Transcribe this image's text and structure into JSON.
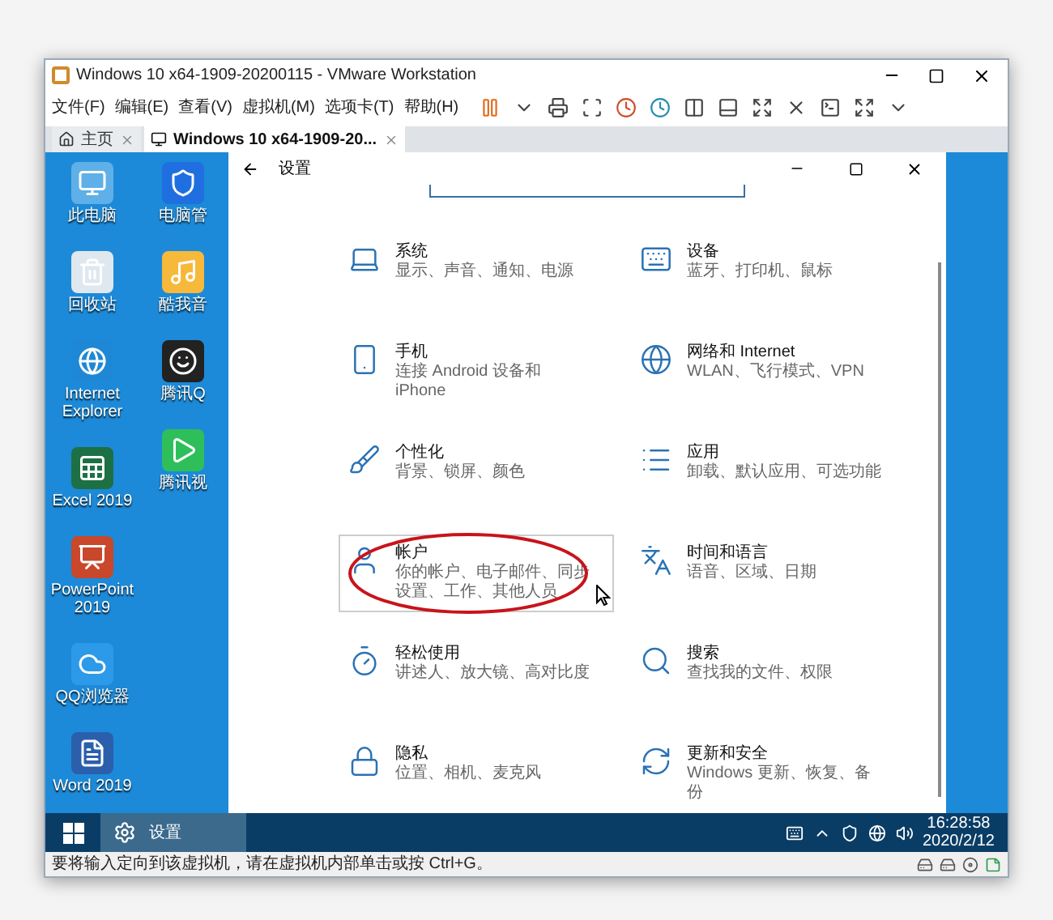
{
  "window": {
    "title": "Windows 10 x64-1909-20200115 - VMware Workstation"
  },
  "menu": [
    "文件(F)",
    "编辑(E)",
    "查看(V)",
    "虚拟机(M)",
    "选项卡(T)",
    "帮助(H)"
  ],
  "tabs": [
    {
      "label": "主页",
      "selected": false
    },
    {
      "label": "Windows 10 x64-1909-20...",
      "selected": true
    }
  ],
  "desktop_icons": [
    {
      "label": "此电脑",
      "kind": "pc"
    },
    {
      "label": "回收站",
      "kind": "bin"
    },
    {
      "label": "Internet Explorer",
      "kind": "ie"
    },
    {
      "label": "Excel 2019",
      "kind": "excel"
    },
    {
      "label": "PowerPoint 2019",
      "kind": "ppt"
    },
    {
      "label": "QQ浏览器",
      "kind": "browser"
    },
    {
      "label": "Word 2019",
      "kind": "word"
    },
    {
      "label": "电脑管",
      "kind": "shield"
    },
    {
      "label": "酷我音",
      "kind": "music"
    },
    {
      "label": "腾讯Q",
      "kind": "qq"
    },
    {
      "label": "腾讯视",
      "kind": "video"
    }
  ],
  "settings_window": {
    "title": "设置",
    "items": [
      {
        "title": "系统",
        "subtitle": "显示、声音、通知、电源",
        "kind": "system",
        "hovered": false
      },
      {
        "title": "设备",
        "subtitle": "蓝牙、打印机、鼠标",
        "kind": "devices",
        "hovered": false
      },
      {
        "title": "手机",
        "subtitle": "连接 Android 设备和 iPhone",
        "kind": "phone",
        "hovered": false
      },
      {
        "title": "网络和 Internet",
        "subtitle": "WLAN、飞行模式、VPN",
        "kind": "network",
        "hovered": false
      },
      {
        "title": "个性化",
        "subtitle": "背景、锁屏、颜色",
        "kind": "personalize",
        "hovered": false
      },
      {
        "title": "应用",
        "subtitle": "卸载、默认应用、可选功能",
        "kind": "apps",
        "hovered": false
      },
      {
        "title": "帐户",
        "subtitle": "你的帐户、电子邮件、同步设置、工作、其他人员",
        "kind": "accounts",
        "hovered": true
      },
      {
        "title": "时间和语言",
        "subtitle": "语音、区域、日期",
        "kind": "time",
        "hovered": false
      },
      {
        "title": "轻松使用",
        "subtitle": "讲述人、放大镜、高对比度",
        "kind": "ease",
        "hovered": false
      },
      {
        "title": "搜索",
        "subtitle": "查找我的文件、权限",
        "kind": "search",
        "hovered": false
      },
      {
        "title": "隐私",
        "subtitle": "位置、相机、麦克风",
        "kind": "privacy",
        "hovered": false
      },
      {
        "title": "更新和安全",
        "subtitle": "Windows 更新、恢复、备份",
        "kind": "update",
        "hovered": false
      }
    ]
  },
  "taskbar": {
    "apps": [
      {
        "label": "设置",
        "selected": true
      }
    ],
    "time": "16:28:58",
    "date": "2020/2/12"
  },
  "status_bar": "要将输入定向到该虚拟机，请在虚拟机内部单击或按 Ctrl+G。"
}
